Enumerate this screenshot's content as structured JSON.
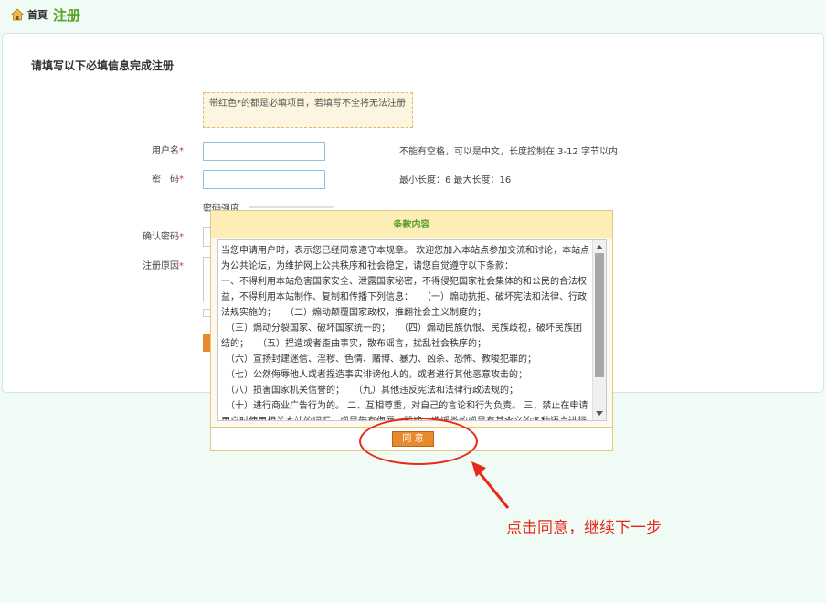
{
  "breadcrumb": {
    "home_label": "首頁",
    "page_title": "注册"
  },
  "form": {
    "title": "请填写以下必填信息完成注册",
    "notice": "带红色*的都是必填项目，若填写不全将无法注册",
    "required_mark": "*",
    "username_label": "用户名",
    "username_hint": "不能有空格，可以是中文，长度控制在 3-12 字节以内",
    "password_label": "密　码",
    "password_hint": "最小长度：6 最大长度：16",
    "strength_label": "密码强度",
    "confirm_label": "确认密码",
    "reason_label": "注册原因"
  },
  "modal": {
    "title": "条款内容",
    "terms": "当您申请用户时，表示您已经同意遵守本规章。 欢迎您加入本站点参加交流和讨论，本站点为公共论坛，为维护网上公共秩序和社会稳定，请您自觉遵守以下条款：\n一、不得利用本站危害国家安全、泄露国家秘密，不得侵犯国家社会集体的和公民的合法权益，不得利用本站制作、复制和传播下列信息：　　（一）煽动抗拒、破坏宪法和法律、行政法规实施的；　　（二）煽动颠覆国家政权，推翻社会主义制度的；\n　（三）煽动分裂国家、破坏国家统一的；　　（四）煽动民族仇恨、民族歧视，破坏民族团结的；　　（五）捏造或者歪曲事实，散布谣言，扰乱社会秩序的；\n　（六）宣扬封建迷信、淫秽、色情、赌博、暴力、凶杀、恐怖、教唆犯罪的；\n　（七）公然侮辱他人或者捏造事实诽谤他人的，或者进行其他恶意攻击的；\n　（八）损害国家机关信誉的；　　（九）其他违反宪法和法律行政法规的；\n　（十）进行商业广告行为的。 二、互相尊重，对自己的言论和行为负责。 三、禁止在申请用户时使用相关本站的词汇，或是带有侮辱、毁谤、造谣类的或是有其含义的各种语言进行注册用户，否则我们会将其删除。",
    "agree_label": "同 意"
  },
  "annotation": {
    "text": "点击同意，继续下一步",
    "color": "#e52a1c"
  },
  "colors": {
    "accent_green": "#58a02a",
    "button_orange": "#e8892b",
    "required_red": "#d83a2a"
  }
}
